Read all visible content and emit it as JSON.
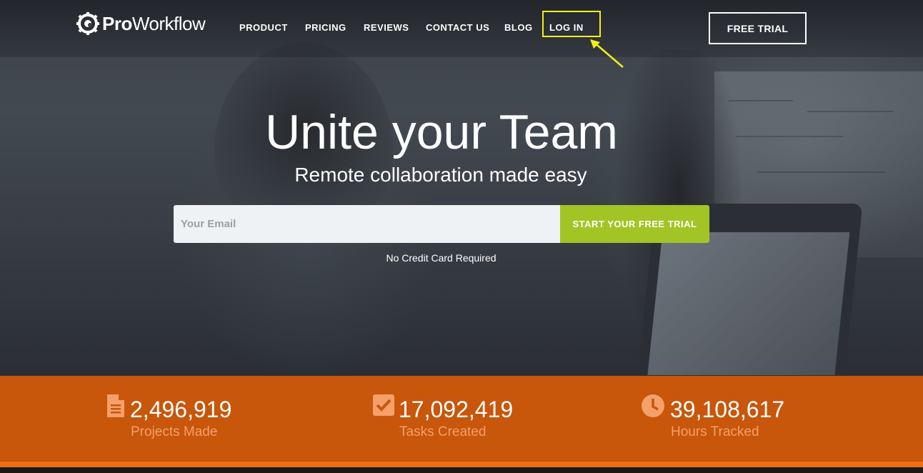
{
  "brand": {
    "name_bold": "Pro",
    "name_regular": "Workflow"
  },
  "nav": {
    "items": [
      {
        "label": "PRODUCT"
      },
      {
        "label": "PRICING"
      },
      {
        "label": "REVIEWS"
      },
      {
        "label": "CONTACT US"
      },
      {
        "label": "BLOG"
      },
      {
        "label": "LOG IN"
      }
    ],
    "trial_label": "FREE TRIAL"
  },
  "hero": {
    "headline": "Unite your Team",
    "subhead": "Remote collaboration made easy",
    "email_placeholder": "Your Email",
    "cta_label": "START YOUR FREE TRIAL",
    "note": "No Credit Card Required"
  },
  "stats": [
    {
      "icon": "document-icon",
      "value": "2,496,919",
      "label": "Projects Made"
    },
    {
      "icon": "checkbox-icon",
      "value": "17,092,419",
      "label": "Tasks Created"
    },
    {
      "icon": "clock-icon",
      "value": "39,108,617",
      "label": "Hours Tracked"
    }
  ],
  "colors": {
    "accent_green": "#a3c425",
    "stats_orange": "#c8560b",
    "stats_label": "#f5a06a",
    "highlight_yellow": "#f2ef19"
  }
}
